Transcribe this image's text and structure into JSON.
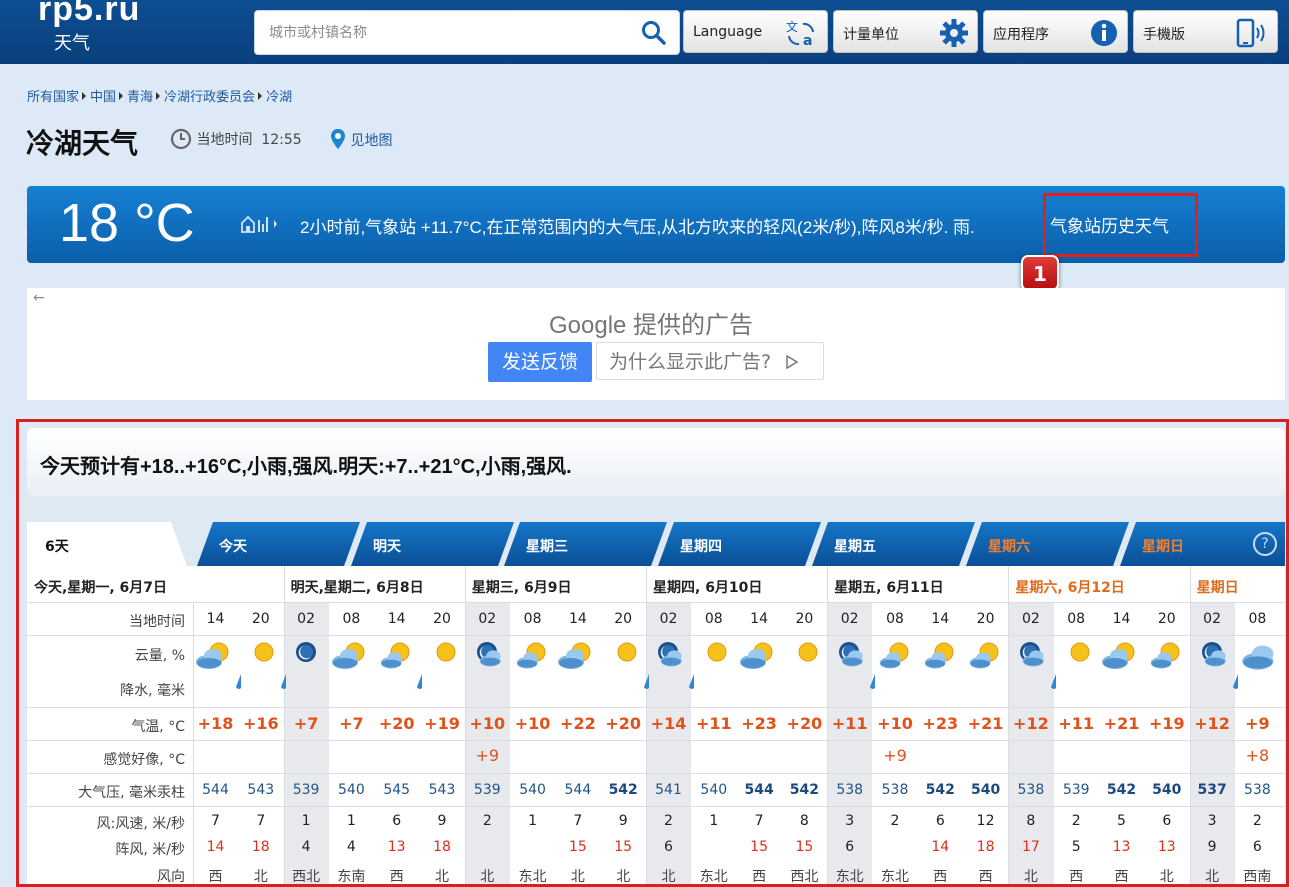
{
  "header": {
    "logo": "rp5.ru",
    "logo_sub": "天气",
    "search_placeholder": "城市或村镇名称",
    "buttons": [
      {
        "label": "Language",
        "icon": "translate-icon"
      },
      {
        "label": "计量单位",
        "icon": "gear-icon"
      },
      {
        "label": "应用程序",
        "icon": "info-icon"
      },
      {
        "label": "手機版",
        "icon": "mobile-icon"
      }
    ]
  },
  "breadcrumb": [
    "所有国家",
    "中国",
    "青海",
    "冷湖行政委员会",
    "冷湖"
  ],
  "page": {
    "title": "冷湖天气",
    "local_time_label": "当地时间",
    "local_time": "12:55",
    "map_link": "见地图"
  },
  "current": {
    "temp": "18 °C",
    "desc": "2小时前,气象站 +11.7°C,在正常范围内的大气压,从北方吹来的轻风(2米/秒),阵风8米/秒. 雨.",
    "history_link": "气象站历史天气",
    "badge": "1"
  },
  "ad": {
    "back": "←",
    "google_text": "Google 提供的广告",
    "feedback": "发送反馈",
    "why": "为什么显示此广告?"
  },
  "forecast": {
    "summary": "今天预计有+18..+16°C,小雨,强风.明天:+7..+21°C,小雨,强风.",
    "tabs": [
      "6天",
      "今天",
      "明天",
      "星期三",
      "星期四",
      "星期五",
      "星期六",
      "星期日"
    ],
    "help": "?",
    "row_labels": {
      "time": "当地时间",
      "cloud": "云量, %",
      "precip": "降水, 毫米",
      "temp": "气温, °C",
      "feel": "感觉好像, °C",
      "pressure": "大气压, 毫米汞柱",
      "wind": "风:风速, 米/秒",
      "gust": "阵风, 米/秒",
      "dir": "风向"
    },
    "days": [
      {
        "label": "今天,星期一, 6月7日",
        "weekend": false
      },
      {
        "label": "明天,星期二, 6月8日",
        "weekend": false
      },
      {
        "label": "星期三, 6月9日",
        "weekend": false
      },
      {
        "label": "星期四, 6月10日",
        "weekend": false
      },
      {
        "label": "星期五, 6月11日",
        "weekend": false
      },
      {
        "label": "星期六, 6月12日",
        "weekend": true
      },
      {
        "label": "星期日",
        "weekend": true
      }
    ],
    "columns": [
      {
        "time": "14",
        "icon": "cloud-sun-icon",
        "rain": true,
        "temp": "+18",
        "feel": "",
        "pres": "544",
        "pb": false,
        "wind": "7",
        "gust": "14",
        "gr": true,
        "dir": "西",
        "night": false
      },
      {
        "time": "20",
        "icon": "sun-icon",
        "rain": true,
        "temp": "+16",
        "feel": "",
        "pres": "543",
        "pb": false,
        "wind": "7",
        "gust": "18",
        "gr": true,
        "dir": "北",
        "night": false
      },
      {
        "time": "02",
        "icon": "night-icon",
        "rain": false,
        "temp": "+7",
        "feel": "",
        "pres": "539",
        "pb": false,
        "wind": "1",
        "gust": "4",
        "gr": false,
        "dir": "西北",
        "night": true
      },
      {
        "time": "08",
        "icon": "cloud-sun-icon",
        "rain": false,
        "temp": "+7",
        "feel": "",
        "pres": "540",
        "pb": false,
        "wind": "1",
        "gust": "4",
        "gr": false,
        "dir": "东南",
        "night": false
      },
      {
        "time": "14",
        "icon": "sun-cloud-icon",
        "rain": true,
        "temp": "+20",
        "feel": "",
        "pres": "545",
        "pb": false,
        "wind": "6",
        "gust": "13",
        "gr": true,
        "dir": "西",
        "night": false
      },
      {
        "time": "20",
        "icon": "sun-icon",
        "rain": false,
        "temp": "+19",
        "feel": "",
        "pres": "543",
        "pb": false,
        "wind": "9",
        "gust": "18",
        "gr": true,
        "dir": "北",
        "night": false
      },
      {
        "time": "02",
        "icon": "night-cloud-icon",
        "rain": false,
        "temp": "+10",
        "feel": "+9",
        "pres": "539",
        "pb": false,
        "wind": "2",
        "gust": "",
        "gr": false,
        "dir": "北",
        "night": true
      },
      {
        "time": "08",
        "icon": "sun-cloud-icon",
        "rain": false,
        "temp": "+10",
        "feel": "",
        "pres": "540",
        "pb": false,
        "wind": "1",
        "gust": "",
        "gr": false,
        "dir": "东北",
        "night": false
      },
      {
        "time": "14",
        "icon": "cloud-sun-icon",
        "rain": false,
        "temp": "+22",
        "feel": "",
        "pres": "544",
        "pb": false,
        "wind": "7",
        "gust": "15",
        "gr": true,
        "dir": "北",
        "night": false
      },
      {
        "time": "20",
        "icon": "sun-icon",
        "rain": true,
        "temp": "+20",
        "feel": "",
        "pres": "542",
        "pb": true,
        "wind": "9",
        "gust": "15",
        "gr": true,
        "dir": "北",
        "night": false
      },
      {
        "time": "02",
        "icon": "night-cloud-icon",
        "rain": true,
        "temp": "+14",
        "feel": "",
        "pres": "541",
        "pb": false,
        "wind": "2",
        "gust": "6",
        "gr": false,
        "dir": "北",
        "night": true
      },
      {
        "time": "08",
        "icon": "sun-icon",
        "rain": false,
        "temp": "+11",
        "feel": "",
        "pres": "540",
        "pb": false,
        "wind": "1",
        "gust": "",
        "gr": false,
        "dir": "东北",
        "night": false
      },
      {
        "time": "14",
        "icon": "cloud-sun-icon",
        "rain": false,
        "temp": "+23",
        "feel": "",
        "pres": "544",
        "pb": true,
        "wind": "7",
        "gust": "15",
        "gr": true,
        "dir": "西",
        "night": false
      },
      {
        "time": "20",
        "icon": "sun-icon",
        "rain": false,
        "temp": "+20",
        "feel": "",
        "pres": "542",
        "pb": true,
        "wind": "8",
        "gust": "15",
        "gr": true,
        "dir": "西北",
        "night": false
      },
      {
        "time": "02",
        "icon": "night-cloud-icon",
        "rain": true,
        "temp": "+11",
        "feel": "",
        "pres": "538",
        "pb": false,
        "wind": "3",
        "gust": "6",
        "gr": false,
        "dir": "东北",
        "night": true
      },
      {
        "time": "08",
        "icon": "sun-cloud-icon",
        "rain": false,
        "temp": "+10",
        "feel": "+9",
        "pres": "538",
        "pb": false,
        "wind": "2",
        "gust": "",
        "gr": false,
        "dir": "东北",
        "night": false
      },
      {
        "time": "14",
        "icon": "sun-cloud-icon",
        "rain": false,
        "temp": "+23",
        "feel": "",
        "pres": "542",
        "pb": true,
        "wind": "6",
        "gust": "14",
        "gr": true,
        "dir": "西",
        "night": false
      },
      {
        "time": "20",
        "icon": "sun-cloud-icon",
        "rain": false,
        "temp": "+21",
        "feel": "",
        "pres": "540",
        "pb": true,
        "wind": "12",
        "gust": "18",
        "gr": true,
        "dir": "西",
        "night": false
      },
      {
        "time": "02",
        "icon": "night-cloud-icon",
        "rain": true,
        "temp": "+12",
        "feel": "",
        "pres": "538",
        "pb": false,
        "wind": "8",
        "gust": "17",
        "gr": true,
        "dir": "北",
        "night": true
      },
      {
        "time": "08",
        "icon": "sun-icon",
        "rain": false,
        "temp": "+11",
        "feel": "",
        "pres": "539",
        "pb": false,
        "wind": "2",
        "gust": "5",
        "gr": false,
        "dir": "西",
        "night": false
      },
      {
        "time": "14",
        "icon": "cloud-sun-icon",
        "rain": false,
        "temp": "+21",
        "feel": "",
        "pres": "542",
        "pb": true,
        "wind": "5",
        "gust": "13",
        "gr": true,
        "dir": "西",
        "night": false
      },
      {
        "time": "20",
        "icon": "sun-cloud-icon",
        "rain": false,
        "temp": "+19",
        "feel": "",
        "pres": "540",
        "pb": true,
        "wind": "6",
        "gust": "13",
        "gr": true,
        "dir": "北",
        "night": false
      },
      {
        "time": "02",
        "icon": "night-cloud-icon",
        "rain": true,
        "temp": "+12",
        "feel": "",
        "pres": "537",
        "pb": true,
        "wind": "3",
        "gust": "9",
        "gr": false,
        "dir": "北",
        "night": true
      },
      {
        "time": "08",
        "icon": "cloud-icon",
        "rain": false,
        "temp": "+9",
        "feel": "+8",
        "pres": "538",
        "pb": false,
        "wind": "2",
        "gust": "6",
        "gr": false,
        "dir": "西南",
        "night": false
      }
    ]
  },
  "colors": {
    "accent": "#0b5eaa",
    "highlight_red": "#e02020",
    "temp_orange": "#e0521a"
  }
}
